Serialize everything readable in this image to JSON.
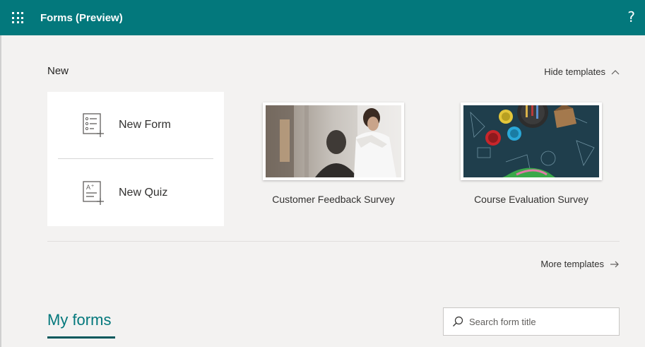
{
  "header": {
    "app_title": "Forms (Preview)",
    "help_label": "?",
    "background_color": "#03787c"
  },
  "new_section": {
    "label": "New",
    "hide_templates_label": "Hide templates",
    "items": [
      {
        "label": "New Form",
        "icon": "new-form-icon"
      },
      {
        "label": "New Quiz",
        "icon": "new-quiz-icon"
      }
    ]
  },
  "templates": [
    {
      "label": "Customer Feedback Survey",
      "image": "office-meeting-photo"
    },
    {
      "label": "Course Evaluation Survey",
      "image": "chalkboard-art-supplies-photo"
    }
  ],
  "more_templates_label": "More templates",
  "my_forms": {
    "title": "My forms",
    "accent_color": "#03787c"
  },
  "search": {
    "placeholder": "Search form title",
    "value": ""
  }
}
